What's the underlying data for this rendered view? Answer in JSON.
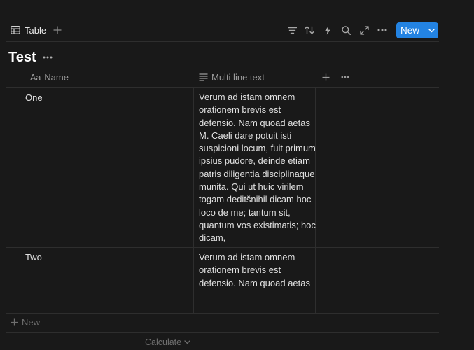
{
  "toolbar": {
    "view_label": "Table",
    "new_label": "New",
    "view_icon": "table-icon",
    "icons": [
      "filter-icon",
      "sort-icon",
      "lightning-icon",
      "search-icon",
      "expand-icon",
      "more-icon"
    ]
  },
  "page": {
    "title": "Test"
  },
  "table": {
    "columns": [
      {
        "icon": "text-aa-icon",
        "icon_text": "Aa",
        "label": "Name"
      },
      {
        "icon": "lines-icon",
        "label": "Multi line text"
      }
    ],
    "rows": [
      {
        "name": "One",
        "lines": [
          "Verum ad istam omnem",
          "orationem brevis est",
          "defensio. Nam quoad aetas",
          "M. Caeli dare potuit isti",
          "suspicioni locum, fuit primum",
          "ipsius pudore, deinde etiam",
          "patris diligentia disciplinaque",
          "munita. Qui ut huic virilem",
          "togam deditšnihil dicam hoc",
          "loco de me; tantum sit,",
          "quantum vos existimatis; hoc",
          "dicam,"
        ]
      },
      {
        "name": "Two",
        "lines": [
          "Verum ad istam omnem",
          "orationem brevis est",
          "defensio. Nam quoad aetas"
        ]
      }
    ],
    "footer_new_label": "New",
    "calculate_label": "Calculate"
  },
  "colors": {
    "accent": "#2383e2",
    "background": "#191919",
    "border": "#2e2e2e"
  }
}
